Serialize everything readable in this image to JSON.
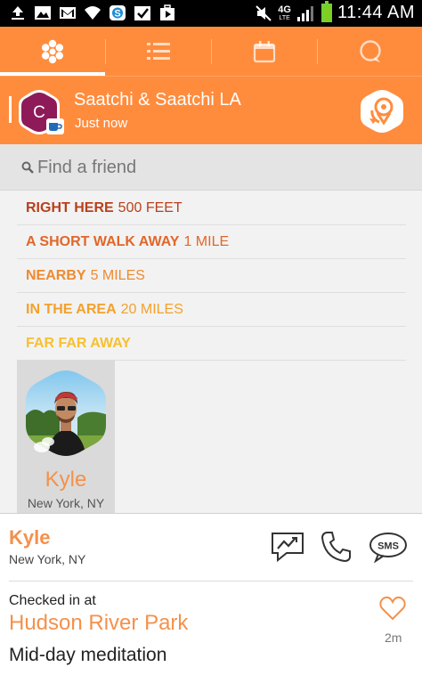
{
  "status_bar": {
    "time": "11:44 AM",
    "network": "4G",
    "network_sub": "LTE",
    "icons": [
      "upload-icon",
      "image-icon",
      "gmail-icon",
      "wifi-icon",
      "skype-icon",
      "checkbox-icon",
      "play-store-icon",
      "mute-icon",
      "signal-icon",
      "battery-icon"
    ]
  },
  "tabs": [
    {
      "name": "friends",
      "icon": "flower-icon",
      "active": true
    },
    {
      "name": "list",
      "icon": "list-icon",
      "active": false
    },
    {
      "name": "calendar",
      "icon": "calendar-icon",
      "active": false
    },
    {
      "name": "chat",
      "icon": "chat-icon",
      "active": false
    }
  ],
  "header": {
    "avatar_letter": "C",
    "title": "Saatchi & Saatchi LA",
    "subtitle": "Just now"
  },
  "search": {
    "placeholder": "Find a friend"
  },
  "distances": [
    {
      "label": "RIGHT HERE",
      "value": "500 FEET",
      "color": "#b8401c"
    },
    {
      "label": "A SHORT WALK AWAY",
      "value": "1 MILE",
      "color": "#e0672a"
    },
    {
      "label": "NEARBY",
      "value": "5 MILES",
      "color": "#ee8a2e"
    },
    {
      "label": "IN THE AREA",
      "value": "20 MILES",
      "color": "#f3a12c"
    },
    {
      "label": "FAR FAR AWAY",
      "value": "",
      "color": "#f7c030"
    }
  ],
  "friend_card": {
    "name": "Kyle",
    "location": "New York, NY"
  },
  "selected": {
    "name": "Kyle",
    "location": "New York, NY",
    "actions": {
      "sms_label": "SMS"
    },
    "checkin_label": "Checked in at",
    "place": "Hudson River Park",
    "note": "Mid-day meditation",
    "time_ago": "2m"
  },
  "colors": {
    "accent": "#ff8c3d",
    "name_orange": "#f4914b"
  }
}
